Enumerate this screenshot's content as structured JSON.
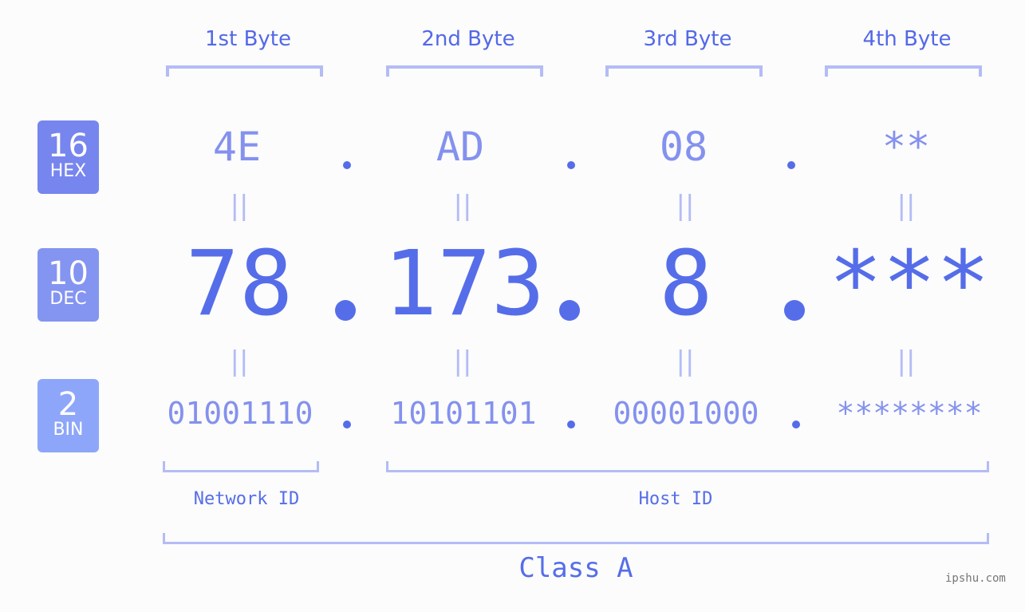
{
  "byte_headers": [
    "1st Byte",
    "2nd Byte",
    "3rd Byte",
    "4th Byte"
  ],
  "badges": {
    "hex": {
      "number": "16",
      "label": "HEX",
      "color": "#7785ee"
    },
    "dec": {
      "number": "10",
      "label": "DEC",
      "color": "#8494f1"
    },
    "bin": {
      "number": "2",
      "label": "BIN",
      "color": "#8da6f9"
    }
  },
  "hex_values": [
    "4E",
    "AD",
    "08",
    "**"
  ],
  "dec_values": [
    "78",
    "173",
    "8",
    "***"
  ],
  "bin_values": [
    "01001110",
    "10101101",
    "00001000",
    "********"
  ],
  "equals_sign": "||",
  "network_id_label": "Network ID",
  "host_id_label": "Host ID",
  "class_label": "Class A",
  "watermark": "ipshu.com",
  "colors": {
    "primary": "#566de9",
    "light": "#8491ee",
    "bracket": "#b4bcf6"
  }
}
